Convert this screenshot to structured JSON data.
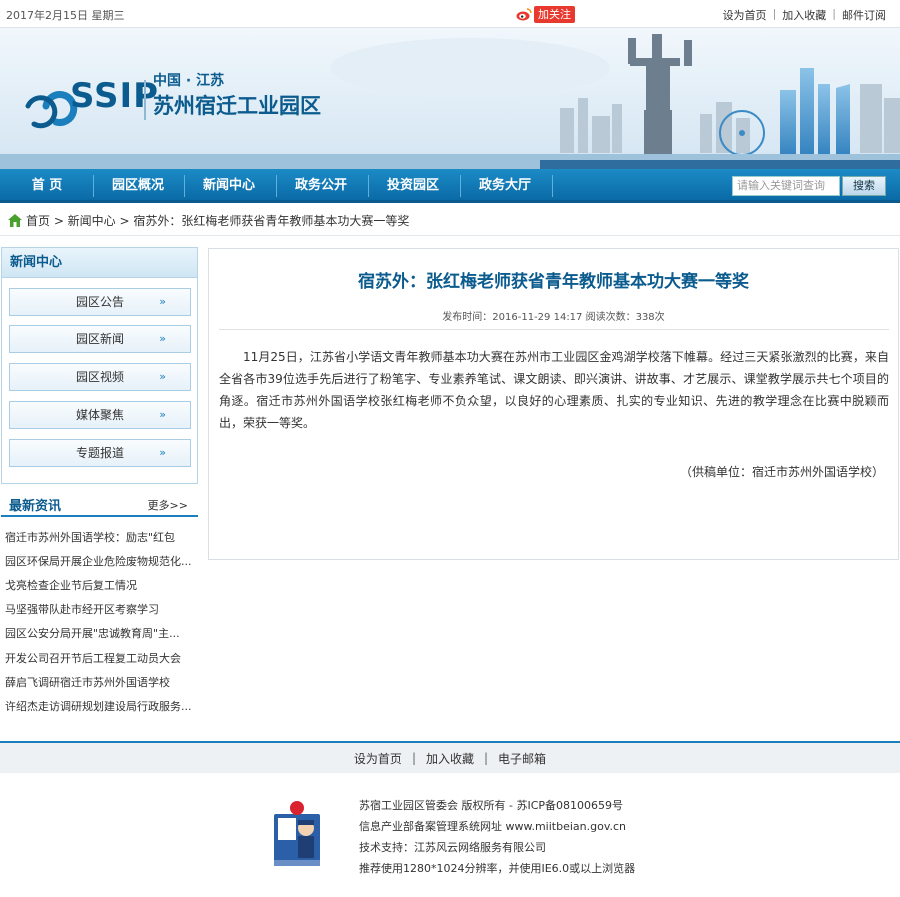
{
  "topbar": {
    "date": "2017年2月15日 星期三",
    "weibo_follow": "加关注",
    "links": [
      "设为首页",
      "加入收藏",
      "邮件订阅"
    ]
  },
  "banner": {
    "logo_text": "SSIP",
    "region": "中国 · 江苏",
    "park_name": "苏州宿迁工业园区"
  },
  "nav": {
    "items": [
      "首  页",
      "园区概况",
      "新闻中心",
      "政务公开",
      "投资园区",
      "政务大厅"
    ],
    "search_placeholder": "请输入关键词查询",
    "search_button": "搜索"
  },
  "breadcrumb": "首页 > 新闻中心 > 宿苏外：张红梅老师获省青年教师基本功大赛一等奖",
  "sidebar": {
    "news_title": "新闻中心",
    "news_buttons": [
      "园区公告",
      "园区新闻",
      "园区视频",
      "媒体聚焦",
      "专题报道"
    ],
    "latest_title": "最新资讯",
    "latest_more": "更多>>",
    "latest_items": [
      "宿迁市苏州外国语学校：励志\"红包",
      "园区环保局开展企业危险废物规范化...",
      "戈亮检查企业节后复工情况",
      "马坚强带队赴市经开区考察学习",
      "园区公安分局开展\"忠诚教育周\"主...",
      "开发公司召开节后工程复工动员大会",
      "薛启飞调研宿迁市苏州外国语学校",
      "许绍杰走访调研规划建设局行政服务..."
    ]
  },
  "article": {
    "title": "宿苏外：张红梅老师获省青年教师基本功大赛一等奖",
    "meta": "发布时间：2016-11-29 14:17  阅读次数：338次",
    "body": "11月25日，江苏省小学语文青年教师基本功大赛在苏州市工业园区金鸡湖学校落下帷幕。经过三天紧张激烈的比赛，来自全省各市39位选手先后进行了粉笔字、专业素养笔试、课文朗读、即兴演讲、讲故事、才艺展示、课堂教学展示共七个项目的角逐。宿迁市苏州外国语学校张红梅老师不负众望，以良好的心理素质、扎实的专业知识、先进的教学理念在比赛中脱颖而出，荣获一等奖。",
    "source": "（供稿单位：宿迁市苏州外国语学校）"
  },
  "footer": {
    "links": [
      "设为首页",
      "加入收藏",
      "电子邮箱"
    ],
    "lines": [
      "苏宿工业园区管委会  版权所有 - 苏ICP备08100659号",
      "信息产业部备案管理系统网址 www.miitbeian.gov.cn",
      "技术支持：江苏风云网络服务有限公司",
      "推荐使用1280*1024分辨率，并使用IE6.0或以上浏览器"
    ]
  },
  "colors": {
    "nav_blue": "#0a6aa6",
    "accent_blue": "#1c7fbd",
    "title_blue": "#0b5b8e",
    "weibo_red": "#e8392f"
  }
}
